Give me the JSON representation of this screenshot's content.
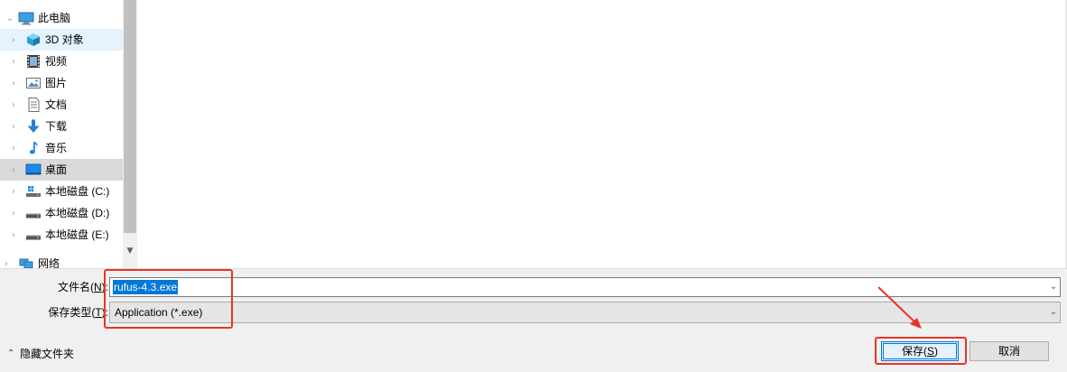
{
  "nav": {
    "items": [
      {
        "label": "此电脑",
        "icon": "computer-icon",
        "state": "normal",
        "root": true,
        "expanded": true
      },
      {
        "label": "3D 对象",
        "icon": "3d-objects-icon",
        "state": "hover"
      },
      {
        "label": "视频",
        "icon": "video-icon",
        "state": "normal"
      },
      {
        "label": "图片",
        "icon": "pictures-icon",
        "state": "normal"
      },
      {
        "label": "文档",
        "icon": "document-icon",
        "state": "normal"
      },
      {
        "label": "下载",
        "icon": "download-arrow-icon",
        "state": "normal"
      },
      {
        "label": "音乐",
        "icon": "music-note-icon",
        "state": "normal"
      },
      {
        "label": "桌面",
        "icon": "desktop-icon",
        "state": "selected"
      },
      {
        "label": "本地磁盘 (C:)",
        "icon": "system-drive-icon",
        "state": "normal"
      },
      {
        "label": "本地磁盘 (D:)",
        "icon": "drive-icon",
        "state": "normal"
      },
      {
        "label": "本地磁盘 (E:)",
        "icon": "drive-icon",
        "state": "normal"
      },
      {
        "label": "网络",
        "icon": "network-icon",
        "state": "normal",
        "root": true
      }
    ]
  },
  "form": {
    "filename_label": "文件名(",
    "filename_key": "N",
    "filename_label_end": "):",
    "filename_value": "rufus-4.3.exe",
    "type_label": "保存类型(",
    "type_key": "T",
    "type_label_end": "):",
    "type_value": "Application (*.exe)"
  },
  "footer": {
    "hide_folders": "隐藏文件夹",
    "save_label": "保存(",
    "save_key": "S",
    "save_label_end": ")",
    "cancel_label": "取消"
  },
  "colors": {
    "annotation": "#e8332a",
    "selection": "#0078d7",
    "hover": "#e5f3ff",
    "selected_row": "#d9d9d9"
  }
}
